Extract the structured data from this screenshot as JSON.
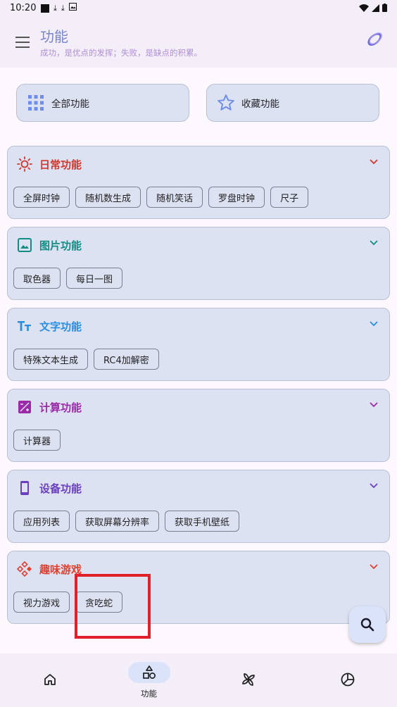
{
  "status_bar": {
    "time": "10:20"
  },
  "app_bar": {
    "title": "功能",
    "subtitle": "成功，是优点的发挥；失败，是缺点的积累。"
  },
  "top_cards": [
    {
      "label": "全部功能",
      "icon": "grid-icon"
    },
    {
      "label": "收藏功能",
      "icon": "star-icon"
    }
  ],
  "sections": [
    {
      "title": "日常功能",
      "icon": "sun-icon",
      "color": "#d0372e",
      "items": [
        "全屏时钟",
        "随机数生成",
        "随机笑话",
        "罗盘时钟",
        "尺子"
      ]
    },
    {
      "title": "图片功能",
      "icon": "image-icon",
      "color": "#138d84",
      "items": [
        "取色器",
        "每日一图"
      ]
    },
    {
      "title": "文字功能",
      "icon": "text-size-icon",
      "color": "#2a8de0",
      "items": [
        "特殊文本生成",
        "RC4加解密"
      ]
    },
    {
      "title": "计算功能",
      "icon": "calculator-icon",
      "color": "#9b2aa8",
      "items": [
        "计算器"
      ]
    },
    {
      "title": "设备功能",
      "icon": "phone-icon",
      "color": "#6a3fc0",
      "items": [
        "应用列表",
        "获取屏幕分辨率",
        "获取手机壁纸"
      ]
    },
    {
      "title": "趣味游戏",
      "icon": "gamepad-icon",
      "color": "#e0402f",
      "items": [
        "视力游戏",
        "贪吃蛇"
      ]
    }
  ],
  "bottom_nav": [
    {
      "icon": "home-icon",
      "label": ""
    },
    {
      "icon": "shapes-icon",
      "label": "功能",
      "active": true
    },
    {
      "icon": "pinwheel-icon",
      "label": ""
    },
    {
      "icon": "pie-chart-icon",
      "label": ""
    }
  ]
}
